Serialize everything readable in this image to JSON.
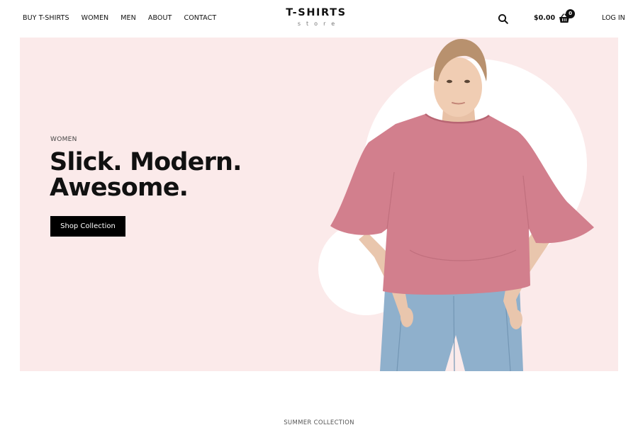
{
  "nav": {
    "items": [
      "BUY T-SHIRTS",
      "WOMEN",
      "MEN",
      "ABOUT",
      "CONTACT"
    ]
  },
  "logo": {
    "main": "T-SHIRTS",
    "sub": "store"
  },
  "header": {
    "cart_total": "$0.00",
    "cart_count": "0",
    "login_label": "LOG IN",
    "search_icon": "search-icon",
    "cart_icon": "basket-icon"
  },
  "hero": {
    "eyebrow": "WOMEN",
    "headline_line1": "Slick. Modern.",
    "headline_line2": "Awesome.",
    "cta_label": "Shop Collection",
    "background_color": "#fbeaea",
    "shirt_color": "#d27f8d",
    "jeans_color": "#8fb0cc"
  },
  "next_section": {
    "label": "SUMMER COLLECTION"
  }
}
